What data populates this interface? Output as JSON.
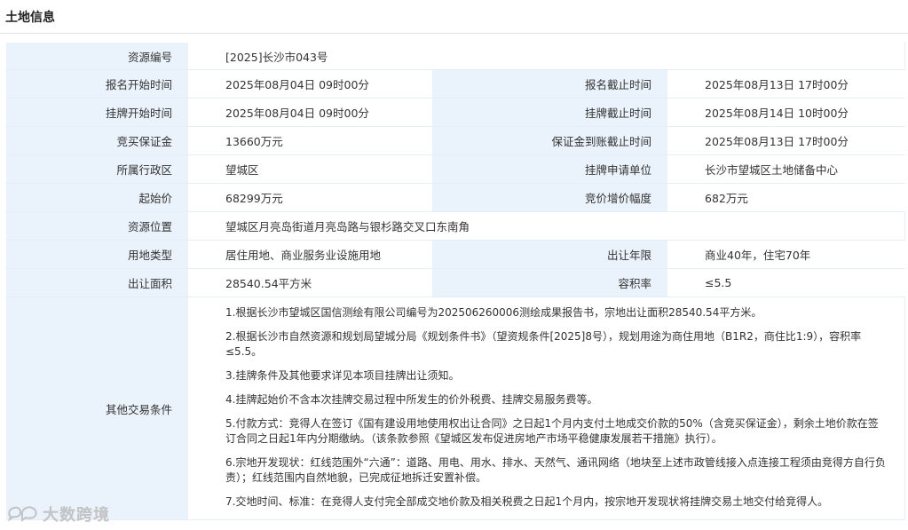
{
  "section_title": "土地信息",
  "rows": {
    "resource_no": {
      "label": "资源编号",
      "value": "[2025]长沙市043号"
    },
    "signup_start": {
      "label": "报名开始时间",
      "value": "2025年08月04日 09时00分"
    },
    "signup_end": {
      "label": "报名截止时间",
      "value": "2025年08月13日 17时00分"
    },
    "listing_start": {
      "label": "挂牌开始时间",
      "value": "2025年08月04日 09时00分"
    },
    "listing_end": {
      "label": "挂牌截止时间",
      "value": "2025年08月14日 10时00分"
    },
    "deposit": {
      "label": "竞买保证金",
      "value": "13660万元"
    },
    "deposit_deadline": {
      "label": "保证金到账截止时间",
      "value": "2025年08月13日 17时00分"
    },
    "district": {
      "label": "所属行政区",
      "value": "望城区"
    },
    "applicant_unit": {
      "label": "挂牌申请单位",
      "value": "长沙市望城区土地储备中心"
    },
    "start_price": {
      "label": "起始价",
      "value": "68299万元"
    },
    "bid_increment": {
      "label": "竞价增价幅度",
      "value": "682万元"
    },
    "location": {
      "label": "资源位置",
      "value": "望城区月亮岛街道月亮岛路与银杉路交叉口东南角"
    },
    "land_use": {
      "label": "用地类型",
      "value": "居住用地、商业服务业设施用地"
    },
    "term": {
      "label": "出让年限",
      "value": "商业40年，住宅70年"
    },
    "area": {
      "label": "出让面积",
      "value": "28540.54平方米"
    },
    "far": {
      "label": "容积率",
      "value": "≤5.5"
    },
    "other_conditions": {
      "label": "其他交易条件",
      "items": [
        "1.根据长沙市望城区国信测绘有限公司编号为202506260006测绘成果报告书，宗地出让面积28540.54平方米。",
        "2.根据长沙市自然资源和规划局望城分局《规划条件书》（望资规条件[2025]8号），规划用途为商住用地（B1R2，商住比1:9），容积率≤5.5。",
        "3.挂牌条件及其他要求详见本项目挂牌出让须知。",
        "4.挂牌起始价不含本次挂牌交易过程中所发生的价外税费、挂牌交易服务费等。",
        "5.付款方式：竞得人在签订《国有建设用地使用权出让合同》之日起1个月内支付土地成交价款的50%（含竞买保证金），剩余土地价款在签订合同之日起1年内分期缴纳。（该条款参照《望城区发布促进房地产市场平稳健康发展若干措施》执行）。",
        "6.宗地开发现状：红线范围外“六通”：道路、用电、用水、排水、天然气、通讯网络（地块至上述市政管线接入点连接工程须由竞得方自行负责）；红线范围内自然地貌，已完成征地拆迁安置补偿。",
        "7.交地时间、标准：在竞得人支付完全部成交地价款及相关税费之日起1个月内，按宗地开发现状将挂牌交易土地交付给竞得人。"
      ]
    }
  },
  "watermark": {
    "text": "大数跨境",
    "icon": "chat-bubbles-logo-icon"
  }
}
